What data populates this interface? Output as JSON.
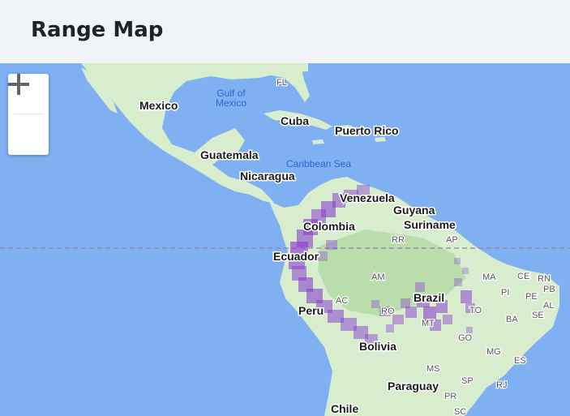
{
  "header": {
    "title": "Range Map"
  },
  "colors": {
    "water": "#7fb0f2",
    "land": "#d7edcd",
    "land_dark": "#b9deac",
    "range": "#8a3fcf",
    "equator": "#9a7fa8"
  },
  "zoom": {
    "in_icon": "plus-icon",
    "out_icon": "minus-icon"
  },
  "labels": {
    "mexico": "Mexico",
    "gulf_line1": "Gulf of",
    "gulf_line2": "Mexico",
    "fl": "FL",
    "cuba": "Cuba",
    "puerto_rico": "Puerto Rico",
    "guatemala": "Guatemala",
    "caribbean": "Caribbean Sea",
    "nicaragua": "Nicaragua",
    "venezuela": "Venezuela",
    "guyana": "Guyana",
    "suriname": "Suriname",
    "colombia": "Colombia",
    "rr": "RR",
    "ap": "AP",
    "ecuador": "Ecuador",
    "am": "AM",
    "ma": "MA",
    "ce": "CE",
    "rn": "RN",
    "pi": "PI",
    "pb": "PB",
    "pe": "PE",
    "al": "AL",
    "brazil": "Brazil",
    "to": "TO",
    "ac": "AC",
    "peru": "Peru",
    "ro": "RO",
    "ba": "BA",
    "se": "SE",
    "mt": "MT",
    "go": "GO",
    "bolivia": "Bolivia",
    "mg": "MG",
    "es": "ES",
    "ms": "MS",
    "sp": "SP",
    "rj": "RJ",
    "paraguay": "Paraguay",
    "pr": "PR",
    "chile": "Chile",
    "sc": "SC"
  }
}
